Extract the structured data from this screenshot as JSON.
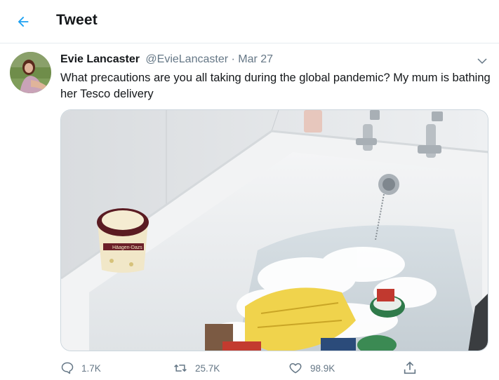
{
  "header": {
    "title": "Tweet",
    "back_icon": "arrow-left-icon",
    "accent": "#1da1f2"
  },
  "tweet": {
    "display_name": "Evie Lancaster",
    "handle": "@EvieLancaster",
    "separator": "·",
    "date": "Mar 27",
    "text": "What precautions are you all taking during the global pandemic? My mum is bathing her Tesco delivery",
    "media_label": "Häagen-Dazs"
  },
  "actions": {
    "reply_count": "1.7K",
    "retweet_count": "25.7K",
    "like_count": "98.9K"
  },
  "colors": {
    "text": "#14171a",
    "muted": "#657786",
    "border": "#e6ecf0"
  }
}
